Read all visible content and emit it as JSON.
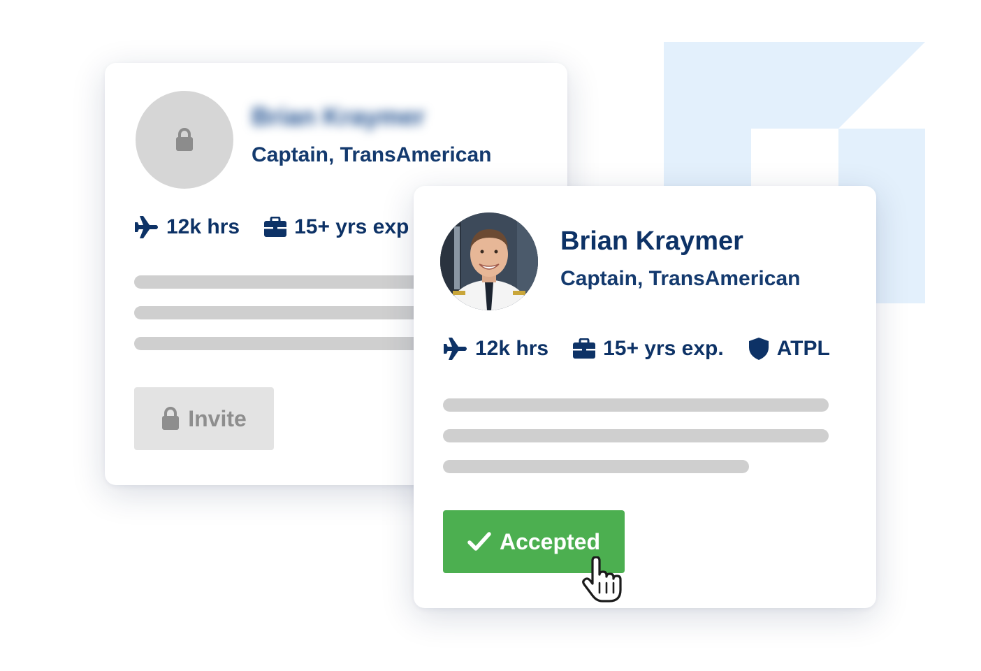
{
  "colors": {
    "navy": "#0d3266",
    "accent_green": "#4caf50",
    "placeholder_gray": "#cfcfcf",
    "deco_blue": "#e3f0fc"
  },
  "back_card": {
    "name": "Brian Kraymer",
    "role": "Captain, TransAmerican",
    "stats": [
      {
        "icon": "airplane-icon",
        "label": "12k hrs"
      },
      {
        "icon": "briefcase-icon",
        "label": "15+ yrs exp"
      }
    ],
    "avatar_icon": "lock-icon",
    "button": {
      "icon": "lock-icon",
      "label": "Invite"
    }
  },
  "front_card": {
    "name": "Brian Kraymer",
    "role": "Captain, TransAmerican",
    "stats": [
      {
        "icon": "airplane-icon",
        "label": "12k hrs"
      },
      {
        "icon": "briefcase-icon",
        "label": "15+ yrs exp."
      },
      {
        "icon": "shield-icon",
        "label": "ATPL"
      }
    ],
    "avatar": "pilot-photo",
    "button": {
      "icon": "checkmark-icon",
      "label": "Accepted"
    }
  },
  "cursor_icon": "hand-pointer-icon"
}
